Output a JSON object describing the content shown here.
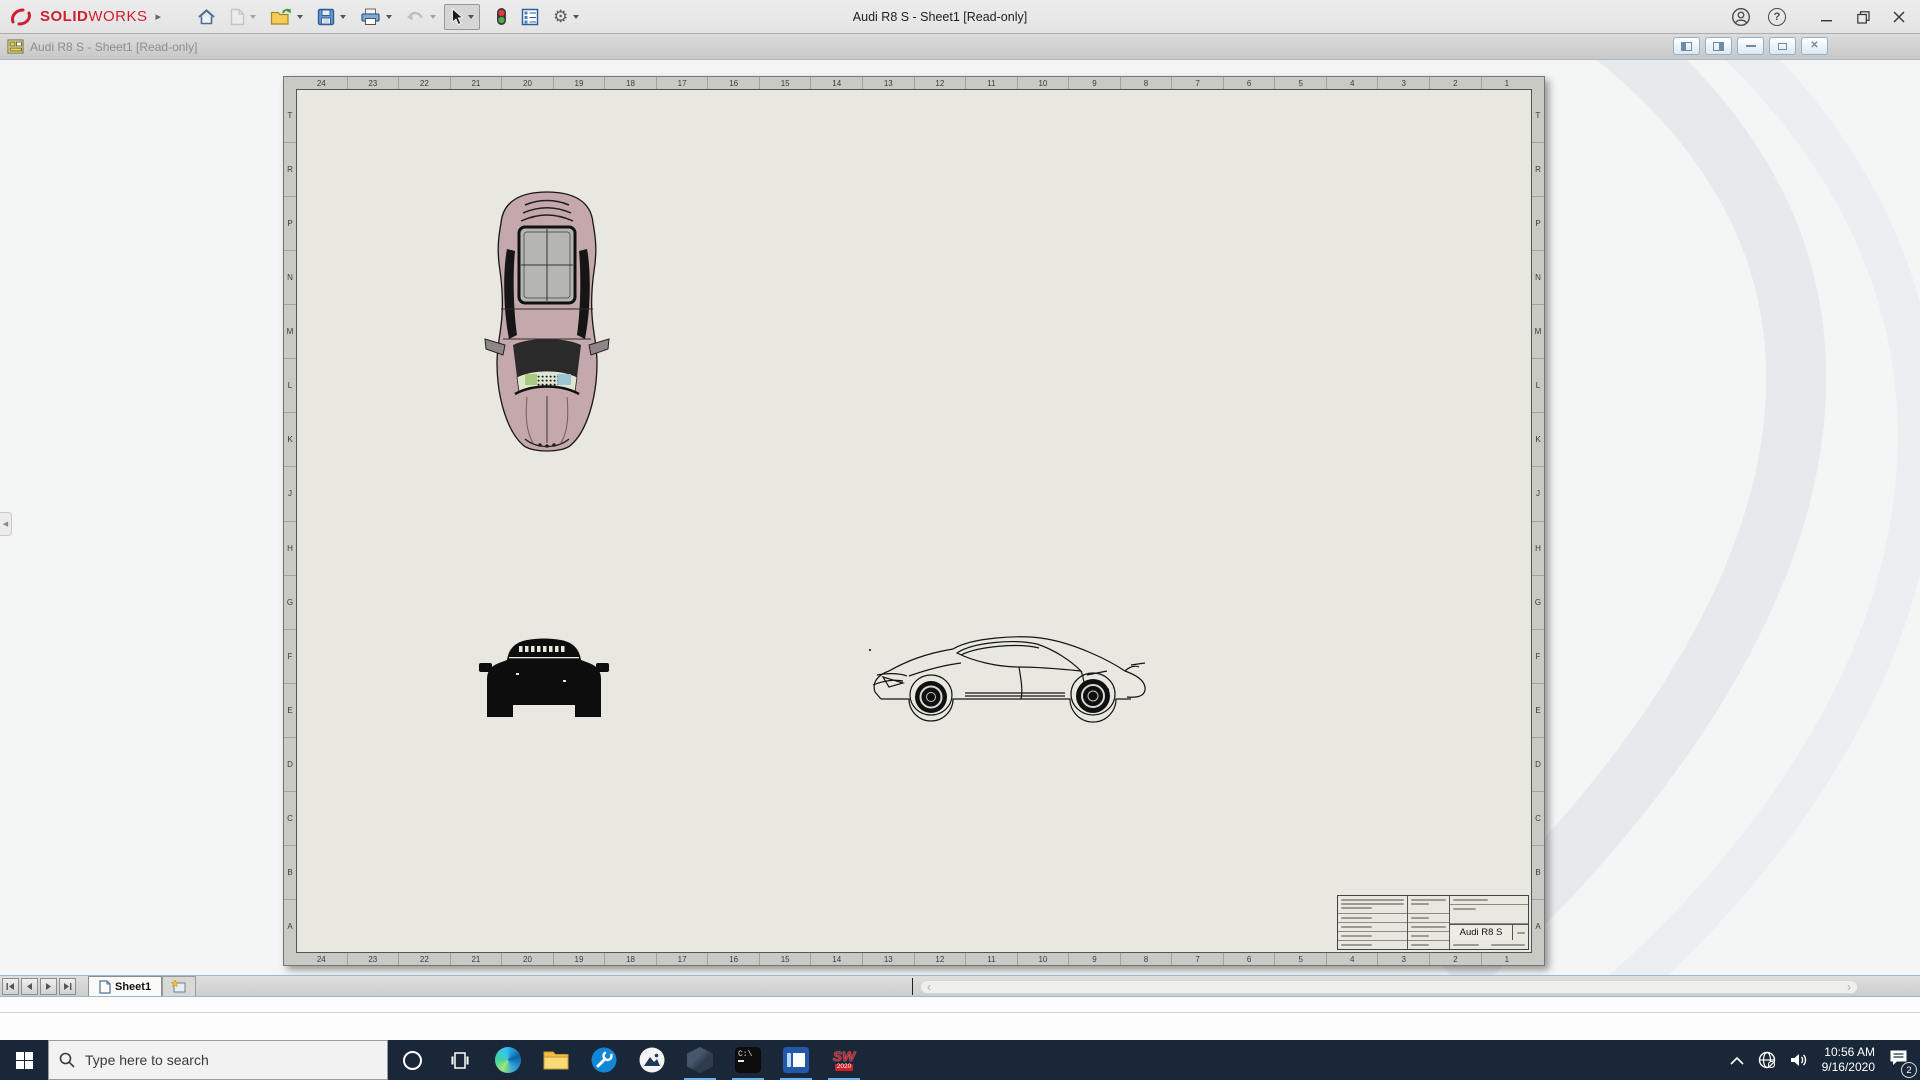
{
  "app": {
    "brand_solid": "SOLID",
    "brand_works": "WORKS",
    "window_title": "Audi R8 S - Sheet1 [Read-only]",
    "help_glyph": "?",
    "toolbar_icons": [
      "home",
      "new-document",
      "open",
      "save",
      "print",
      "undo",
      "select-cursor",
      "rebuild-traffic-light",
      "bom-table",
      "options-gear"
    ],
    "titlebar_icons": [
      "account",
      "help",
      "minimize",
      "restore",
      "close"
    ]
  },
  "document_window": {
    "title": "Audi R8 S - Sheet1 [Read-only]",
    "buttons": [
      "toggle-left-panel",
      "toggle-right-panel",
      "minimize",
      "restore",
      "close"
    ]
  },
  "sheet": {
    "zone_columns": [
      "24",
      "23",
      "22",
      "21",
      "20",
      "19",
      "18",
      "17",
      "16",
      "15",
      "14",
      "13",
      "12",
      "11",
      "10",
      "9",
      "8",
      "7",
      "6",
      "5",
      "4",
      "3",
      "2",
      "1"
    ],
    "zone_rows": [
      "T",
      "R",
      "P",
      "N",
      "M",
      "L",
      "K",
      "J",
      "H",
      "G",
      "F",
      "E",
      "D",
      "C",
      "B",
      "A"
    ],
    "views": [
      "top-view-shaded",
      "front-view-silhouette",
      "side-view-wireframe"
    ],
    "title_block": {
      "title": "Audi R8 S"
    }
  },
  "tabbar": {
    "sheet_tab": "Sheet1"
  },
  "taskbar": {
    "search_placeholder": "Type here to search",
    "apps": [
      "edge",
      "file-explorer",
      "tools",
      "photos",
      "hexagon-app",
      "command-prompt",
      "media-app",
      "solidworks-2020"
    ],
    "running_apps": [
      "hexagon-app",
      "command-prompt",
      "media-app",
      "solidworks-2020"
    ],
    "cmd_glyph": "C:\\",
    "solidworks_label": "SW",
    "solidworks_year": "2020",
    "tray": {
      "time": "10:56 AM",
      "date": "9/16/2020",
      "notification_badge": "2"
    }
  },
  "colors": {
    "accent_red": "#cf2030",
    "taskbar_bg": "#1a2738",
    "paper": "#e8e8e0",
    "running_indicator": "#6cb2e8"
  }
}
